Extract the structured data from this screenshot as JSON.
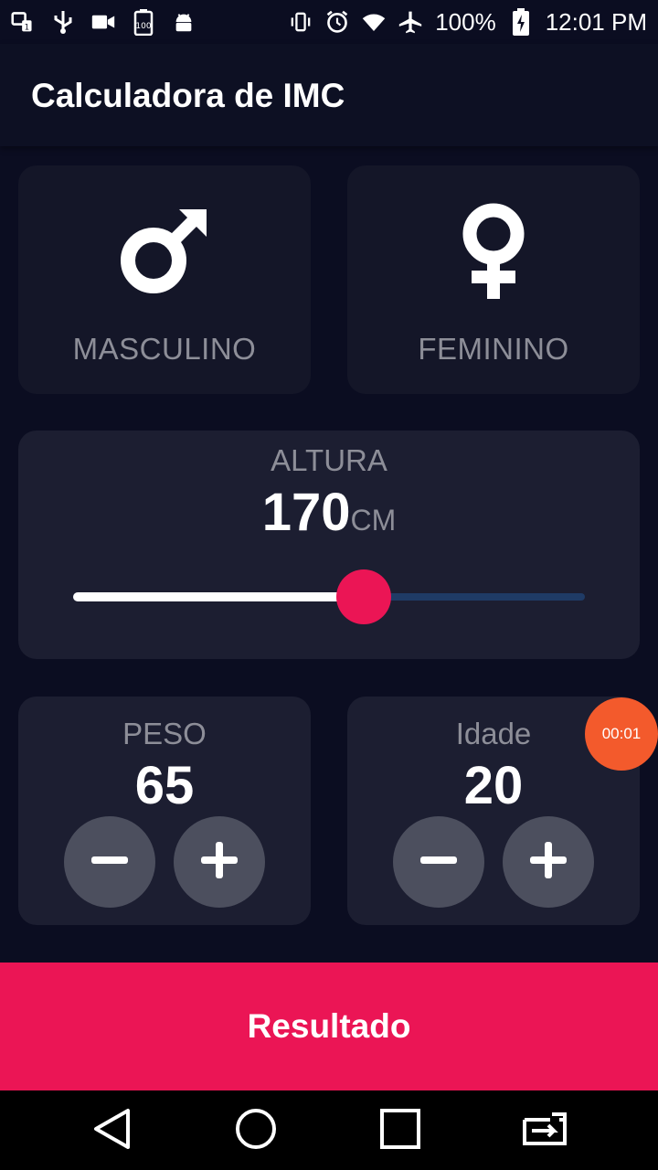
{
  "status_bar": {
    "battery_text": "100%",
    "time": "12:01 PM",
    "icons_left": [
      "notification-icon",
      "usb-icon",
      "video-icon",
      "battery-100-icon",
      "android-icon"
    ],
    "icons_right": [
      "vibrate-icon",
      "alarm-icon",
      "wifi-icon",
      "airplane-icon",
      "battery-charging-icon"
    ]
  },
  "app_bar": {
    "title": "Calculadora de IMC"
  },
  "gender": {
    "male": {
      "label": "MASCULINO",
      "icon": "male-symbol-icon"
    },
    "female": {
      "label": "FEMININO",
      "icon": "female-symbol-icon"
    }
  },
  "height": {
    "label": "ALTURA",
    "value": "170",
    "unit": "CM",
    "slider_fraction": 0.567
  },
  "weight": {
    "label": "PESO",
    "value": "65"
  },
  "age": {
    "label": "Idade",
    "value": "20"
  },
  "result": {
    "label": "Resultado"
  },
  "timer_overlay": {
    "text": "00:01"
  },
  "colors": {
    "background": "#0b0d21",
    "card": "#1c1e31",
    "accent": "#eb1555",
    "label_gray": "#8d8e98",
    "round_button": "#4c4f5e",
    "timer": "#f35a2c"
  }
}
